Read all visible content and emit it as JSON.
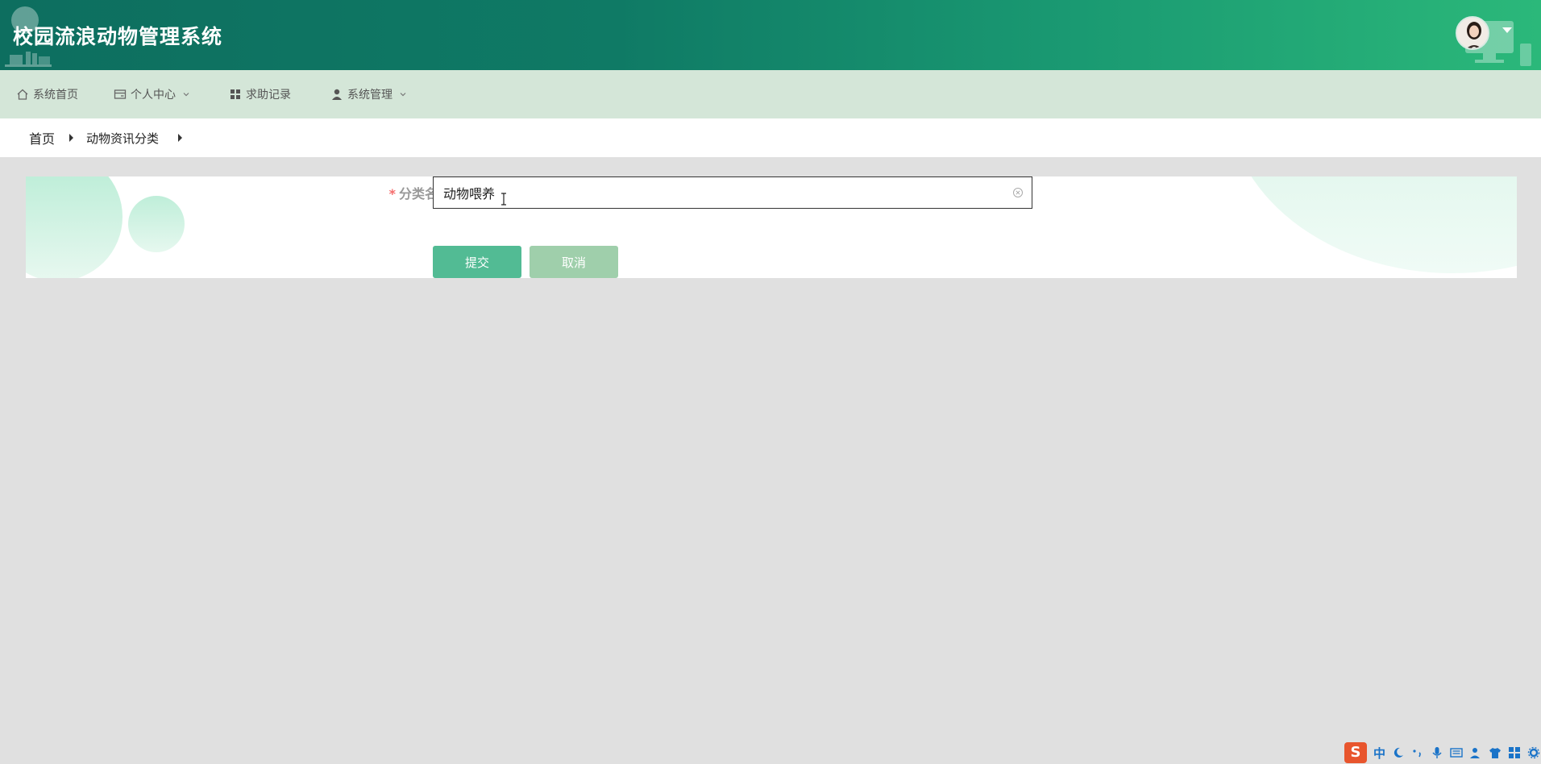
{
  "header": {
    "title": "校园流浪动物管理系统"
  },
  "nav": {
    "items": [
      {
        "label": "系统首页",
        "icon": "home-icon"
      },
      {
        "label": "个人中心",
        "icon": "card-icon",
        "has_dropdown": true
      },
      {
        "label": "求助记录",
        "icon": "grid-icon"
      },
      {
        "label": "系统管理",
        "icon": "user-icon",
        "has_dropdown": true
      }
    ]
  },
  "breadcrumb": {
    "items": [
      "首页",
      "动物资讯分类"
    ]
  },
  "form": {
    "field_label": "分类名称",
    "required_mark": "*",
    "field_value": "动物喂养",
    "submit_label": "提交",
    "cancel_label": "取消"
  },
  "ime": {
    "lang": "中"
  },
  "colors": {
    "header_start": "#0d6e5f",
    "header_end": "#2bb87a",
    "nav_bg": "#d4e6d8",
    "submit": "#52bb94",
    "cancel": "#9fcfab",
    "required": "#f56c6c"
  }
}
